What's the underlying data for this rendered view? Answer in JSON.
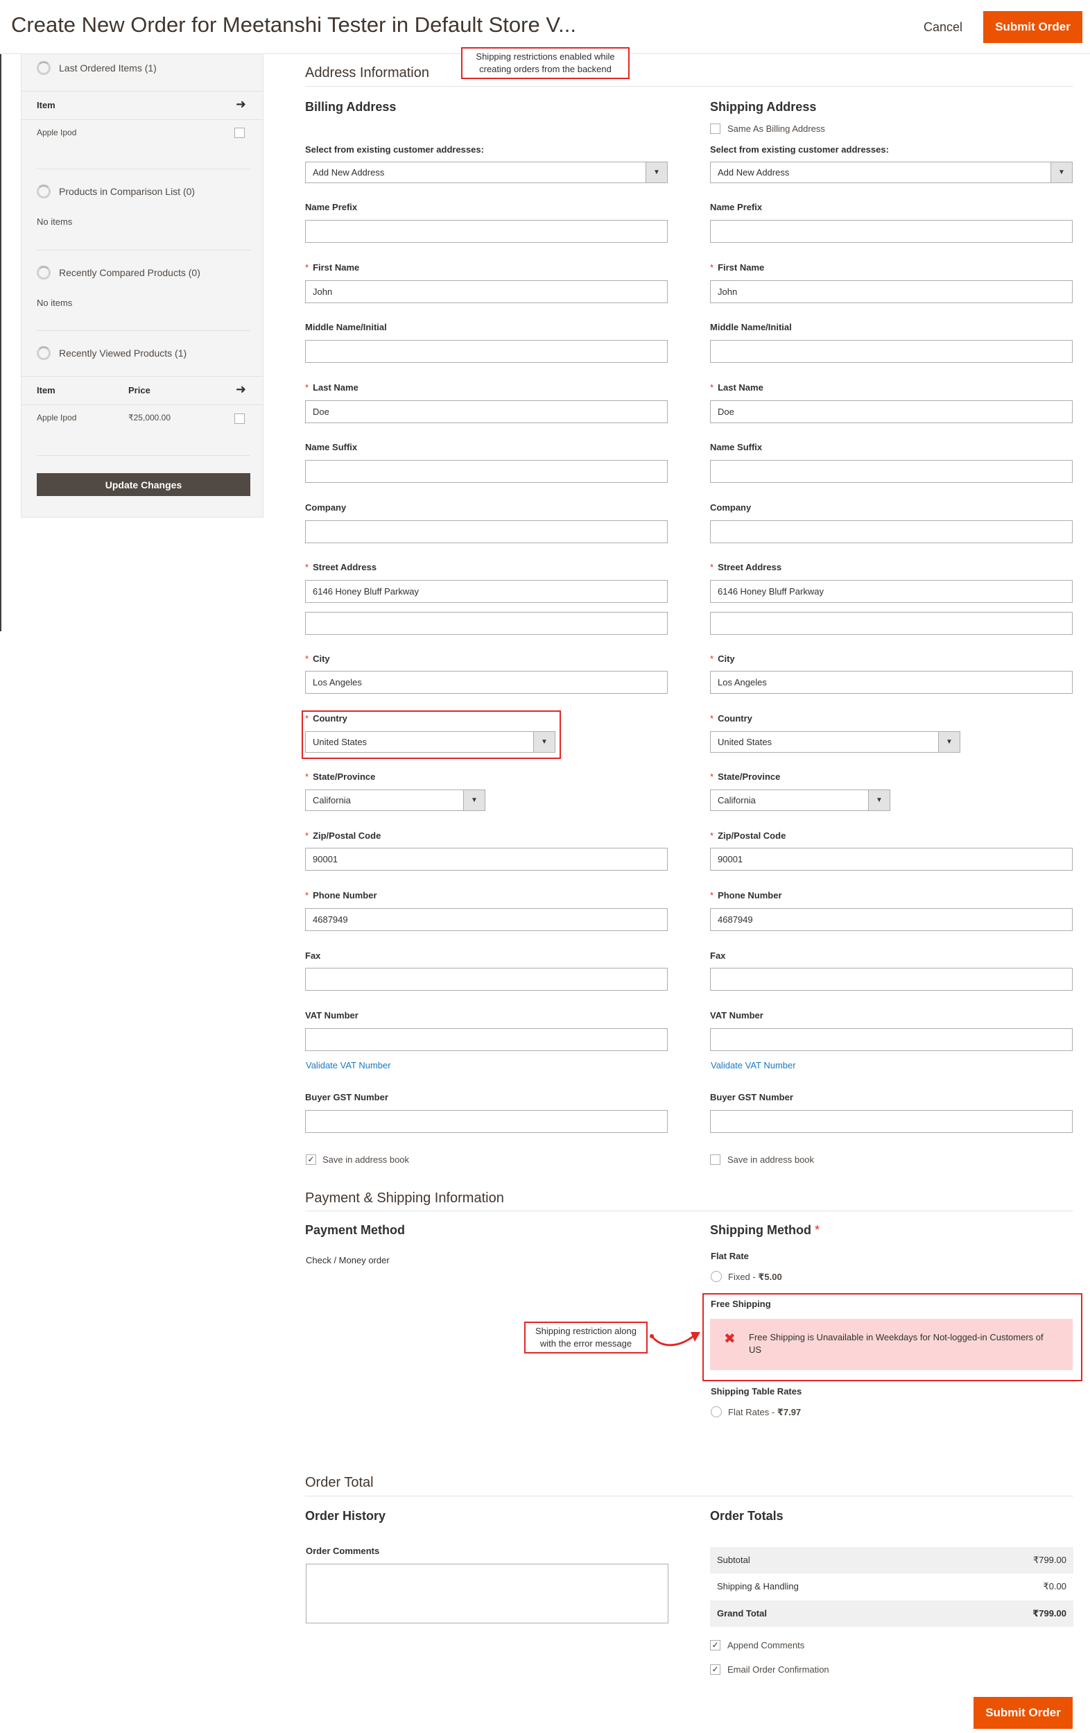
{
  "header": {
    "title": "Create New Order for Meetanshi Tester in Default Store V...",
    "cancel_label": "Cancel",
    "submit_label": "Submit Order"
  },
  "callouts": {
    "shipping_restrictions": "Shipping restrictions enabled while creating orders from the backend",
    "error_message": "Shipping restriction along with the error message"
  },
  "sidebar": {
    "last_ordered": {
      "title": "Last Ordered Items (1)",
      "col_item": "Item",
      "rows": [
        {
          "item": "Apple Ipod"
        }
      ]
    },
    "comparison": {
      "title": "Products in Comparison List (0)",
      "empty": "No items"
    },
    "recently_compared": {
      "title": "Recently Compared Products (0)",
      "empty": "No items"
    },
    "recently_viewed": {
      "title": "Recently Viewed Products (1)",
      "col_item": "Item",
      "col_price": "Price",
      "rows": [
        {
          "item": "Apple Ipod",
          "price": "₹25,000.00"
        }
      ]
    },
    "update_label": "Update Changes"
  },
  "address": {
    "section_title": "Address Information",
    "billing": {
      "title": "Billing Address",
      "select_label": "Select from existing customer addresses:",
      "select_value": "Add New Address",
      "name_prefix": {
        "label": "Name Prefix",
        "value": ""
      },
      "first_name": {
        "label": "First Name",
        "value": "John"
      },
      "middle_name": {
        "label": "Middle Name/Initial",
        "value": ""
      },
      "last_name": {
        "label": "Last Name",
        "value": "Doe"
      },
      "name_suffix": {
        "label": "Name Suffix",
        "value": ""
      },
      "company": {
        "label": "Company",
        "value": ""
      },
      "street": {
        "label": "Street Address",
        "line1": "6146 Honey Bluff Parkway",
        "line2": ""
      },
      "city": {
        "label": "City",
        "value": "Los Angeles"
      },
      "country": {
        "label": "Country",
        "value": "United States"
      },
      "state": {
        "label": "State/Province",
        "value": "California"
      },
      "zip": {
        "label": "Zip/Postal Code",
        "value": "90001"
      },
      "phone": {
        "label": "Phone Number",
        "value": "4687949"
      },
      "fax": {
        "label": "Fax",
        "value": ""
      },
      "vat": {
        "label": "VAT Number",
        "value": "",
        "validate_link": "Validate VAT Number"
      },
      "gst": {
        "label": "Buyer GST Number",
        "value": ""
      },
      "save_label": "Save in address book",
      "save_checked": true
    },
    "shipping": {
      "title": "Shipping Address",
      "same_as_billing": "Same As Billing Address",
      "select_label": "Select from existing customer addresses:",
      "select_value": "Add New Address",
      "name_prefix": {
        "label": "Name Prefix",
        "value": ""
      },
      "first_name": {
        "label": "First Name",
        "value": "John"
      },
      "middle_name": {
        "label": "Middle Name/Initial",
        "value": ""
      },
      "last_name": {
        "label": "Last Name",
        "value": "Doe"
      },
      "name_suffix": {
        "label": "Name Suffix",
        "value": ""
      },
      "company": {
        "label": "Company",
        "value": ""
      },
      "street": {
        "label": "Street Address",
        "line1": "6146 Honey Bluff Parkway",
        "line2": ""
      },
      "city": {
        "label": "City",
        "value": "Los Angeles"
      },
      "country": {
        "label": "Country",
        "value": "United States"
      },
      "state": {
        "label": "State/Province",
        "value": "California"
      },
      "zip": {
        "label": "Zip/Postal Code",
        "value": "90001"
      },
      "phone": {
        "label": "Phone Number",
        "value": "4687949"
      },
      "fax": {
        "label": "Fax",
        "value": ""
      },
      "vat": {
        "label": "VAT Number",
        "value": "",
        "validate_link": "Validate VAT Number"
      },
      "gst": {
        "label": "Buyer GST Number",
        "value": ""
      },
      "save_label": "Save in address book",
      "save_checked": false
    }
  },
  "payment_shipping": {
    "section_title": "Payment & Shipping Information",
    "payment_title": "Payment Method",
    "payment_value": "Check / Money order",
    "shipping_title": "Shipping Method",
    "flat_rate": {
      "title": "Flat Rate",
      "option": "Fixed",
      "price": "₹5.00"
    },
    "free_shipping": {
      "title": "Free Shipping",
      "error": "Free Shipping is Unavailable in Weekdays for Not-logged-in Customers of US"
    },
    "table_rates": {
      "title": "Shipping Table Rates",
      "option": "Flat Rates",
      "price": "₹7.97"
    }
  },
  "order_total": {
    "section_title": "Order Total",
    "history_title": "Order History",
    "comments_label": "Order Comments",
    "totals_title": "Order Totals",
    "rows": [
      {
        "label": "Subtotal",
        "value": "₹799.00"
      },
      {
        "label": "Shipping & Handling",
        "value": "₹0.00"
      },
      {
        "label": "Grand Total",
        "value": "₹799.00"
      }
    ],
    "append_comments": "Append Comments",
    "email_confirmation": "Email Order Confirmation",
    "submit_label": "Submit Order"
  },
  "colors": {
    "accent": "#eb5202",
    "callout_border": "#e22626",
    "error_bg": "#fcd6d6",
    "link": "#1979c3"
  }
}
